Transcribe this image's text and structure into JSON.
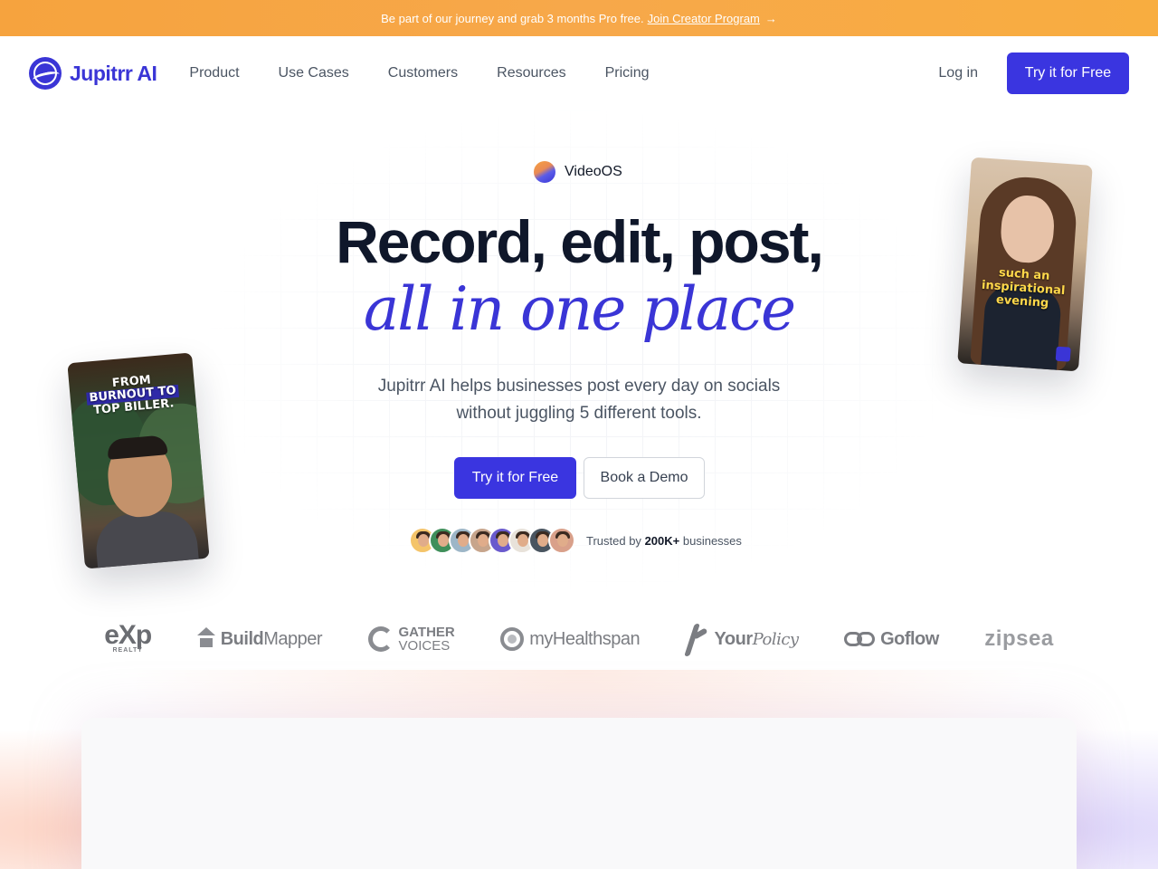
{
  "announcement": {
    "text": "Be part of our journey and grab 3 months Pro free.",
    "link": "Join Creator Program",
    "arrow": "→"
  },
  "nav": {
    "brand": "Jupitrr AI",
    "items": [
      {
        "label": "Product"
      },
      {
        "label": "Use Cases"
      },
      {
        "label": "Customers"
      },
      {
        "label": "Resources"
      },
      {
        "label": "Pricing"
      }
    ],
    "login": "Log in",
    "cta": "Try it for Free"
  },
  "hero": {
    "badge": "VideoOS",
    "headline": "Record, edit, post,",
    "headline_italic": "all in one place",
    "subtitle": "Jupitrr AI helps businesses post every day on socials without juggling 5 different tools.",
    "primary_cta": "Try it for Free",
    "secondary_cta": "Book a Demo",
    "trusted_prefix": "Trusted by",
    "trusted_count": "200K+",
    "trusted_suffix": "businesses",
    "avatar_colors": [
      "#f4c46a",
      "#3f8f5a",
      "#9db6c7",
      "#c7a58c",
      "#6a5acd",
      "#e8e2da",
      "#4a5560",
      "#d9a08a"
    ]
  },
  "cards": {
    "left_caption_line1": "FROM",
    "left_caption_line2": "BURNOUT TO",
    "left_caption_line3": "TOP BILLER.",
    "right_caption": "such an inspirational evening"
  },
  "logos": {
    "exp": "eXp",
    "exp_sub": "REALTY",
    "buildmapper_bold": "Build",
    "buildmapper_rest": "Mapper",
    "gather_line1": "GATHER",
    "gather_line2": "VOICES",
    "myhealthspan": "myHealthspan",
    "yourpolicy_bold": "Your",
    "yourpolicy_italic": "Policy",
    "goflow": "Goflow",
    "zipsea": "zipsea"
  },
  "colors": {
    "brand": "#3a35d6",
    "cta": "#3a35e0",
    "announcement": "#f7a84a"
  }
}
